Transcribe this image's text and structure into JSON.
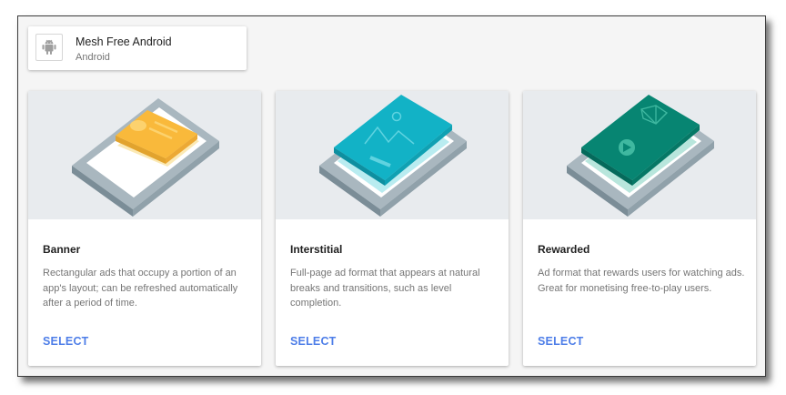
{
  "app": {
    "name": "Mesh Free Android",
    "platform": "Android",
    "icon": "android-icon"
  },
  "ad_formats": [
    {
      "title": "Banner",
      "description": "Rectangular ads that occupy a portion of an app's layout; can be refreshed automatically after a period of time.",
      "action": "SELECT"
    },
    {
      "title": "Interstitial",
      "description": "Full-page ad format that appears at natural breaks and transitions, such as level completion.",
      "action": "SELECT"
    },
    {
      "title": "Rewarded",
      "description": "Ad format that rewards users for watching ads. Great for monetising free-to-play users.",
      "action": "SELECT"
    }
  ],
  "colors": {
    "accent": "#4e7ee8",
    "banner_ad": "#f9b93b",
    "interstitial_ad": "#12b2c6",
    "rewarded_ad": "#078572"
  }
}
